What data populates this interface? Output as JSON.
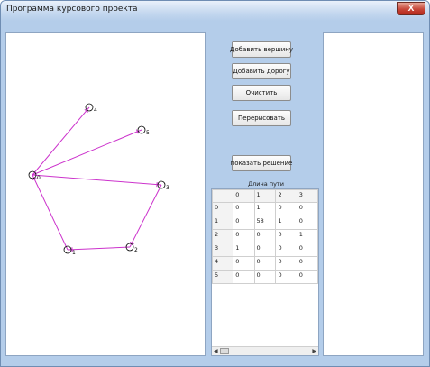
{
  "window": {
    "title": "Программа курсового проекта",
    "close_label": "X"
  },
  "buttons": {
    "add_vertex": "Добавить вершину",
    "add_road": "Добавить дорогу",
    "clear": "Очистить",
    "redraw": "Перерисовать",
    "show_solution": "показать решение"
  },
  "table": {
    "caption": "Длина пути",
    "header": [
      "",
      "0",
      "1",
      "2",
      "3"
    ],
    "rows": [
      [
        "0",
        "0",
        "1",
        "0",
        "0"
      ],
      [
        "1",
        "0",
        "58",
        "1",
        "0"
      ],
      [
        "2",
        "0",
        "0",
        "0",
        "1"
      ],
      [
        "3",
        "1",
        "0",
        "0",
        "0"
      ],
      [
        "4",
        "0",
        "0",
        "0",
        "0"
      ],
      [
        "5",
        "0",
        "0",
        "0",
        "0"
      ]
    ]
  },
  "graph": {
    "vertex_labels": [
      "0",
      "1",
      "2",
      "3",
      "4",
      "5"
    ],
    "edge_color": "#cc33cc",
    "vertex_color": "#000000"
  }
}
